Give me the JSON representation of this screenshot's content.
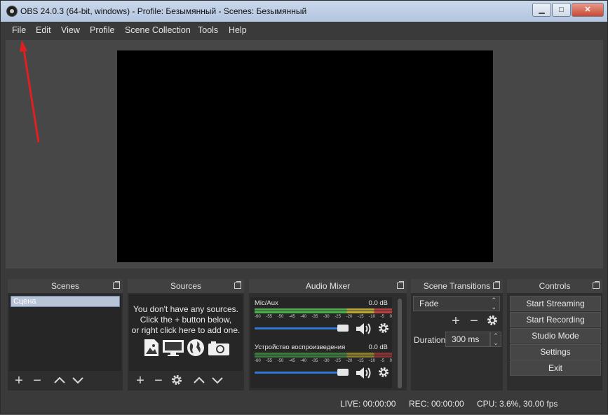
{
  "window": {
    "title": "OBS 24.0.3 (64-bit, windows) - Profile: Безымянный - Scenes: Безымянный",
    "minimize_label": "▭",
    "maximize_label": "□",
    "close_label": "✕"
  },
  "menu": {
    "items": [
      "File",
      "Edit",
      "View",
      "Profile",
      "Scene Collection",
      "Tools",
      "Help"
    ]
  },
  "docks": {
    "scenes": {
      "title": "Scenes",
      "items": [
        "Сцена"
      ]
    },
    "sources": {
      "title": "Sources",
      "hint_lines": [
        "You don't have any sources.",
        "Click the + button below,",
        "or right click here to add one."
      ]
    },
    "mixer": {
      "title": "Audio Mixer",
      "channels": [
        {
          "name": "Mic/Aux",
          "db": "0.0 dB"
        },
        {
          "name": "Устройство воспроизведения",
          "db": "0.0 dB"
        }
      ],
      "scale_labels": [
        "-60",
        "-55",
        "-50",
        "-45",
        "-40",
        "-35",
        "-30",
        "-25",
        "-20",
        "-15",
        "-10",
        "-5",
        "0"
      ]
    },
    "transitions": {
      "title": "Scene Transitions",
      "selected": "Fade",
      "duration_label": "Duration",
      "duration_value": "300 ms"
    },
    "controls": {
      "title": "Controls",
      "buttons": [
        "Start Streaming",
        "Start Recording",
        "Studio Mode",
        "Settings",
        "Exit"
      ]
    }
  },
  "status": {
    "live": "LIVE: 00:00:00",
    "rec": "REC: 00:00:00",
    "cpu": "CPU: 3.6%, 30.00 fps"
  },
  "colors": {
    "annotation_arrow": "#e02020",
    "meter_green": "#4cae4c",
    "meter_yellow": "#b8a832",
    "meter_red": "#b84040",
    "slider_blue": "#2f78d1"
  }
}
